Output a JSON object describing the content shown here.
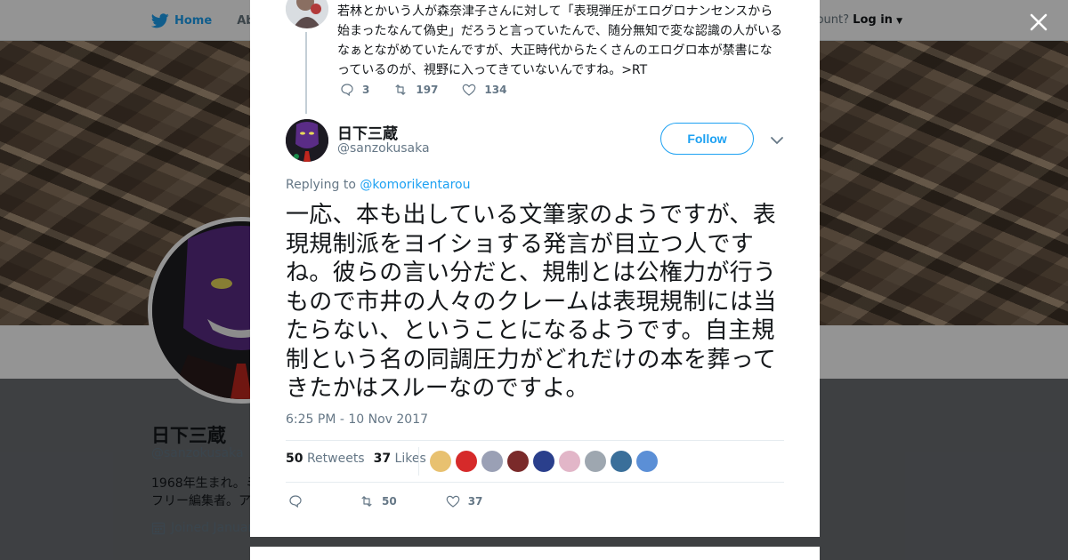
{
  "topbar": {
    "home_label": "Home",
    "about_label": "Abo",
    "account_prompt": "ccount?",
    "login_label": "Log in"
  },
  "profile": {
    "name": "日下三蔵",
    "handle": "@sanzokusaka",
    "bio_line1": "1968年生まれ。ミ",
    "bio_line2": "フリー編集者。ア",
    "joined": "Joined Januar"
  },
  "previous_tweet": {
    "text": "若林とかいう人が森奈津子さんに対して「表現弾圧がエログロナンセンスから始まったなんて偽史」だろうと言っていたんで、随分無知で変な認識の人がいるなぁとながめていたんですが、大正時代からたくさんのエログロ本が禁書になっているのが、視野に入ってきていないんですね。>RT",
    "replies": "3",
    "retweets": "197",
    "likes": "134"
  },
  "tweet": {
    "author_name": "日下三蔵",
    "author_handle": "@sanzokusaka",
    "follow_label": "Follow",
    "replying_prefix": "Replying to",
    "replying_to": "@komorikentarou",
    "text": "一応、本も出している文筆家のようですが、表現規制派をヨイショする発言が目立つ人ですね。彼らの言い分だと、規制とは公権力が行うもので市井の人々のクレームは表現規制には当たらない、ということになるようです。自主規制という名の同調圧力がどれだけの本を葬ってきたかはスルーなのですよ。",
    "timestamp": "6:25 PM - 10 Nov 2017",
    "retweet_count": "50",
    "retweets_label": "Retweets",
    "like_count": "37",
    "likes_label": "Likes",
    "action_replies": "",
    "action_retweets": "50",
    "action_likes": "37"
  },
  "likers": [
    "#e8c170",
    "#d62a2a",
    "#9aa0b5",
    "#7a2a2a",
    "#2a3f8c",
    "#e2b6c8",
    "#9ea7b0",
    "#3a6f9a",
    "#5b8fd6"
  ],
  "colors": {
    "accent": "#1da1f2",
    "text": "#14171a",
    "muted": "#657786"
  }
}
